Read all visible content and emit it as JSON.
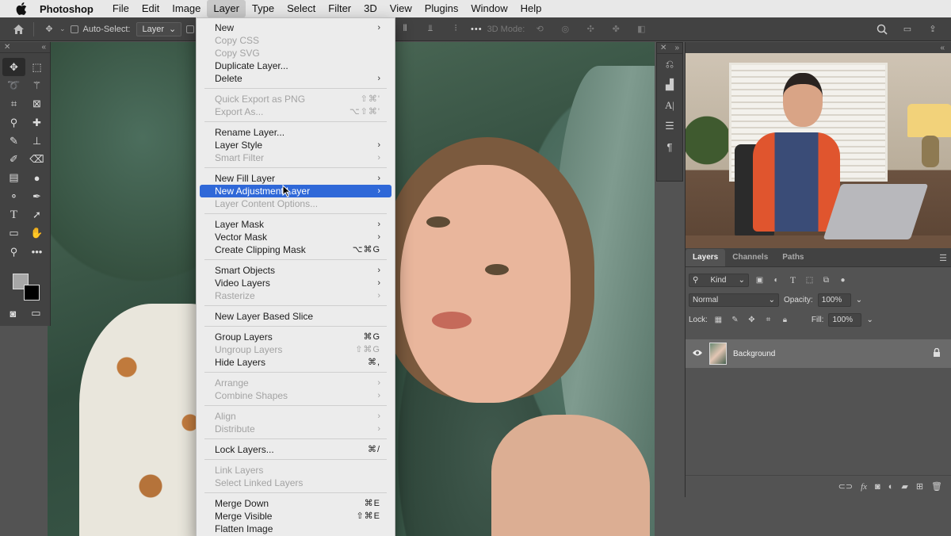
{
  "menubar": {
    "app_name": "Photoshop",
    "items": [
      "File",
      "Edit",
      "Image",
      "Layer",
      "Type",
      "Select",
      "Filter",
      "3D",
      "View",
      "Plugins",
      "Window",
      "Help"
    ],
    "active": "Layer"
  },
  "options_bar": {
    "auto_select_label": "Auto-Select:",
    "auto_select_value": "Layer",
    "mode_label": "3D Mode:",
    "more": "•••"
  },
  "layer_menu": [
    {
      "label": "New",
      "submenu": true
    },
    {
      "label": "Copy CSS",
      "disabled": true
    },
    {
      "label": "Copy SVG",
      "disabled": true
    },
    {
      "label": "Duplicate Layer..."
    },
    {
      "label": "Delete",
      "submenu": true
    },
    {
      "sep": true
    },
    {
      "label": "Quick Export as PNG",
      "disabled": true,
      "shortcut": "⇧⌘'"
    },
    {
      "label": "Export As...",
      "disabled": true,
      "shortcut": "⌥⇧⌘'"
    },
    {
      "sep": true
    },
    {
      "label": "Rename Layer..."
    },
    {
      "label": "Layer Style",
      "submenu": true
    },
    {
      "label": "Smart Filter",
      "disabled": true,
      "submenu": true
    },
    {
      "sep": true
    },
    {
      "label": "New Fill Layer",
      "submenu": true
    },
    {
      "label": "New Adjustment Layer",
      "submenu": true,
      "highlight": true
    },
    {
      "label": "Layer Content Options...",
      "disabled": true
    },
    {
      "sep": true
    },
    {
      "label": "Layer Mask",
      "submenu": true
    },
    {
      "label": "Vector Mask",
      "submenu": true
    },
    {
      "label": "Create Clipping Mask",
      "shortcut": "⌥⌘G"
    },
    {
      "sep": true
    },
    {
      "label": "Smart Objects",
      "submenu": true
    },
    {
      "label": "Video Layers",
      "submenu": true
    },
    {
      "label": "Rasterize",
      "disabled": true,
      "submenu": true
    },
    {
      "sep": true
    },
    {
      "label": "New Layer Based Slice"
    },
    {
      "sep": true
    },
    {
      "label": "Group Layers",
      "shortcut": "⌘G"
    },
    {
      "label": "Ungroup Layers",
      "disabled": true,
      "shortcut": "⇧⌘G"
    },
    {
      "label": "Hide Layers",
      "shortcut": "⌘,"
    },
    {
      "sep": true
    },
    {
      "label": "Arrange",
      "disabled": true,
      "submenu": true
    },
    {
      "label": "Combine Shapes",
      "disabled": true,
      "submenu": true
    },
    {
      "sep": true
    },
    {
      "label": "Align",
      "disabled": true,
      "submenu": true
    },
    {
      "label": "Distribute",
      "disabled": true,
      "submenu": true
    },
    {
      "sep": true
    },
    {
      "label": "Lock Layers...",
      "shortcut": "⌘/"
    },
    {
      "sep": true
    },
    {
      "label": "Link Layers",
      "disabled": true
    },
    {
      "label": "Select Linked Layers",
      "disabled": true
    },
    {
      "sep": true
    },
    {
      "label": "Merge Down",
      "shortcut": "⌘E"
    },
    {
      "label": "Merge Visible",
      "shortcut": "⇧⌘E"
    },
    {
      "label": "Flatten Image"
    }
  ],
  "layers_panel": {
    "tabs": [
      "Layers",
      "Channels",
      "Paths"
    ],
    "active_tab": "Layers",
    "filter_kind": "Kind",
    "blend_mode": "Normal",
    "opacity_label": "Opacity:",
    "opacity_value": "100%",
    "lock_label": "Lock:",
    "fill_label": "Fill:",
    "fill_value": "100%",
    "layers": [
      {
        "name": "Background",
        "visible": true,
        "locked": true
      }
    ]
  },
  "colors": {
    "menu_highlight": "#2f68d8",
    "panel_bg": "#535353",
    "toolbar_bg": "#424242"
  }
}
